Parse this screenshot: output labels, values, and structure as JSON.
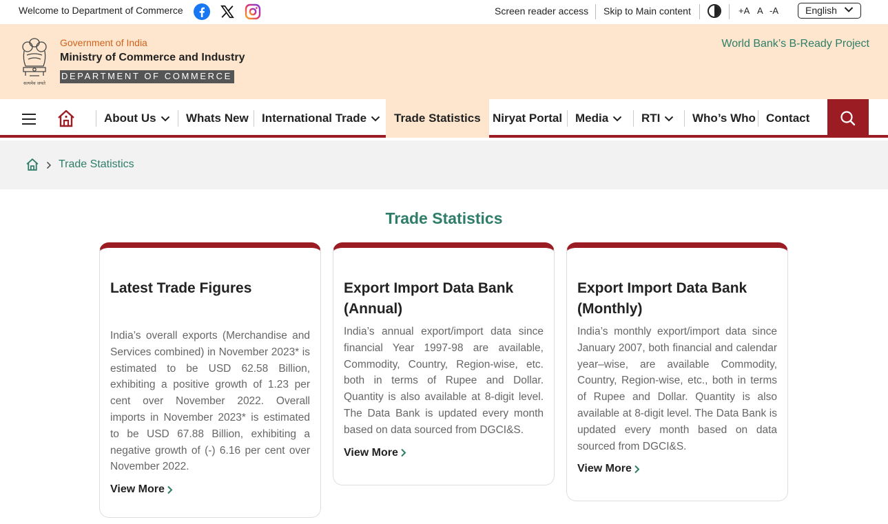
{
  "topbar": {
    "welcome": "Welcome to Department of Commerce",
    "social": [
      "facebook-icon",
      "x-icon",
      "instagram-icon"
    ],
    "screen_reader": "Screen reader access",
    "skip_main": "Skip to Main content",
    "font_plus": "+A",
    "font_normal": "A",
    "font_minus": "-A",
    "language": "English"
  },
  "header": {
    "gov": "Government of India",
    "ministry": "Ministry of Commerce and Industry",
    "dept": "DEPARTMENT OF COMMERCE",
    "emblem_caption": "सत्यमेव जयते",
    "world_bank": "World Bank’s B-Ready Project"
  },
  "nav": {
    "items": [
      {
        "label": "About Us",
        "dropdown": true
      },
      {
        "label": "Whats New",
        "dropdown": false
      },
      {
        "label": "International Trade",
        "dropdown": true
      },
      {
        "label": "Trade Statistics",
        "dropdown": false,
        "active": true
      },
      {
        "label": "Niryat Portal",
        "dropdown": false
      },
      {
        "label": "Media",
        "dropdown": true
      },
      {
        "label": "RTI",
        "dropdown": true
      },
      {
        "label": "Who’s Who",
        "dropdown": false
      },
      {
        "label": "Contact",
        "dropdown": false
      }
    ]
  },
  "breadcrumb": {
    "current": "Trade Statistics"
  },
  "main": {
    "title": "Trade Statistics",
    "cards": [
      {
        "title": "Latest Trade Figures",
        "body": "India’s overall exports (Merchandise and Services combined) in November 2023* is estimated to be USD 62.58 Billion, exhibiting a positive growth of 1.23 per cent over November 2022. Overall imports in November 2023* is estimated to be USD 67.88 Billion, exhibiting a negative growth of (-) 6.16 per cent over November 2022.",
        "link": "View More"
      },
      {
        "title": "Export Import Data Bank (Annual)",
        "body": "India’s annual export/import data since financial Year 1997-98 are available, Commodity, Country, Region-wise, etc. both in terms of Rupee and Dollar. Quantity is also available at 8-digit level. The Data Bank is updated every month based on data sourced from DGCI&S.",
        "link": "View More"
      },
      {
        "title": "Export Import Data Bank (Monthly)",
        "body": "India’s monthly export/import data since January 2007, both financial and calendar year–wise, are available Commodity, Country, Region-wise, etc., both in terms of Rupee and Dollar. Quantity is also available at 8-digit level. The Data Bank is updated every month based on data sourced from DGCI&S.",
        "link": "View More"
      }
    ]
  },
  "colors": {
    "maroon": "#9c1c24",
    "green": "#2e7d68",
    "peach": "#fde6cd",
    "orange": "#d0621e"
  }
}
